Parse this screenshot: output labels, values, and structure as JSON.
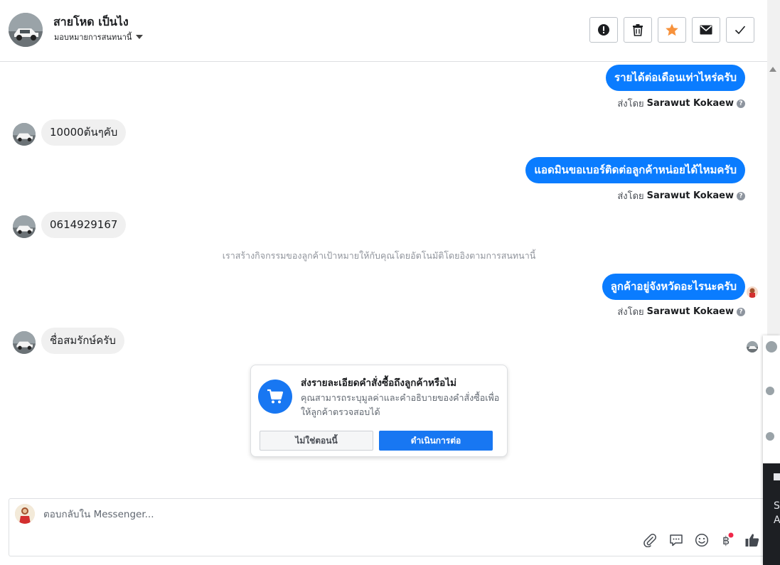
{
  "header": {
    "contact_name": "สายโหด เป็นไง",
    "subtitle": "มอบหมายการสนทนานี้",
    "actions": [
      {
        "name": "spam-alert-button",
        "icon": "exclamation-circle-icon"
      },
      {
        "name": "delete-button",
        "icon": "trash-icon"
      },
      {
        "name": "star-button",
        "icon": "star-icon"
      },
      {
        "name": "mark-unread-button",
        "icon": "envelope-icon"
      },
      {
        "name": "mark-done-button",
        "icon": "checkmark-icon"
      }
    ]
  },
  "messages": [
    {
      "direction": "out",
      "text": "รายได้ต่อเดือนเท่าไหร่ครับ",
      "sent_by_prefix": "ส่งโดย",
      "sent_by": "Sarawut Kokaew"
    },
    {
      "direction": "in",
      "text": "10000ต้นๆคับ"
    },
    {
      "direction": "out",
      "text": "แอดมินขอเบอร์ติดต่อลูกค้าหน่อยได้ไหมครับ",
      "sent_by_prefix": "ส่งโดย",
      "sent_by": "Sarawut Kokaew"
    },
    {
      "direction": "in",
      "text": "0614929167"
    },
    {
      "direction": "system",
      "text": "เราสร้างกิจกรรมของลูกค้าเป้าหมายให้กับคุณโดยอัตโนมัติโดยอิงตามการสนทนานี้"
    },
    {
      "direction": "out",
      "text": "ลูกค้าอยู่จังหวัดอะไรนะครับ",
      "sent_by_prefix": "ส่งโดย",
      "sent_by": "Sarawut Kokaew"
    },
    {
      "direction": "in",
      "text": "ชื่อสมรักษ์ครับ"
    }
  ],
  "order_prompt": {
    "title": "ส่งรายละเอียดคำสั่งซื้อถึงลูกค้าหรือไม่",
    "body": "คุณสามารถระบุมูลค่าและคำอธิบายของคำสั่งซื้อเพื่อให้ลูกค้าตรวจสอบได้",
    "icon": "shopping-cart-icon",
    "secondary_label": "ไม่ใช่ตอนนี้",
    "primary_label": "ดำเนินการต่อ"
  },
  "composer": {
    "placeholder": "ตอบกลับใน Messenger...",
    "tools": [
      "paperclip-icon",
      "quick-reply-icon",
      "emoji-icon",
      "baht-payment-icon",
      "thumbs-up-icon"
    ]
  },
  "side_panel": {
    "text_line1": "S",
    "text_line2": "A"
  },
  "colors": {
    "accent": "#0a7cff",
    "primary_button": "#1877f2",
    "star": "#f7923b",
    "notification_dot": "#f02849"
  }
}
